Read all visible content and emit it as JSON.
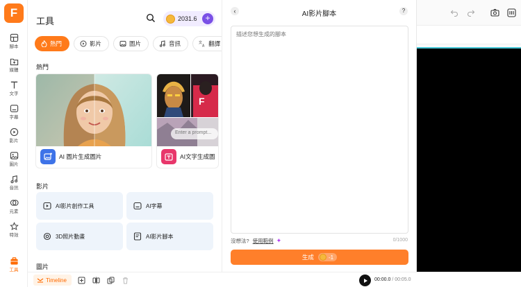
{
  "logo": {
    "letter": "F"
  },
  "rail": {
    "items": [
      {
        "label": "腳本",
        "icon": "script-icon"
      },
      {
        "label": "媒體",
        "icon": "media-icon"
      },
      {
        "label": "文字",
        "icon": "text-icon"
      },
      {
        "label": "字幕",
        "icon": "subtitle-icon"
      },
      {
        "label": "影片",
        "icon": "video-icon"
      },
      {
        "label": "圖片",
        "icon": "image-icon"
      },
      {
        "label": "音訊",
        "icon": "audio-icon"
      },
      {
        "label": "元素",
        "icon": "elements-icon"
      },
      {
        "label": "特效",
        "icon": "effects-icon"
      },
      {
        "label": "工具",
        "icon": "tools-icon"
      }
    ]
  },
  "panel": {
    "title": "工具",
    "credits": "2031.6",
    "tabs": [
      {
        "label": "熱門",
        "icon": "fire-icon"
      },
      {
        "label": "影片",
        "icon": "video-icon"
      },
      {
        "label": "圖片",
        "icon": "image-icon"
      },
      {
        "label": "音訊",
        "icon": "music-icon"
      },
      {
        "label": "翻譯",
        "icon": "translate-icon"
      }
    ],
    "hot_title": "熱門",
    "cards": [
      {
        "label": "AI 圖片生成圖片"
      },
      {
        "label": "AI文字生成圖",
        "prompt_placeholder": "Enter a prompt..."
      }
    ],
    "video_title": "影片",
    "video_tools": [
      {
        "label": "AI影片創作工具",
        "icon": "video-create-icon"
      },
      {
        "label": "AI字幕",
        "icon": "subtitle-icon"
      },
      {
        "label": "3D照片動畫",
        "icon": "3d-photo-icon"
      },
      {
        "label": "AI影片腳本",
        "icon": "script-icon"
      }
    ],
    "image_title": "圖片"
  },
  "script": {
    "title": "AI影片腳本",
    "placeholder": "描述您想生成的腳本",
    "idea_text": "沒想法?",
    "example_link": "使用範例",
    "counter": "0/1000",
    "generate_label": "生成",
    "generate_cost": "-1"
  },
  "bottom": {
    "timeline_label": "Timeline",
    "current_time": "00:00.0",
    "total_time": "/ 00:05.0"
  },
  "colors": {
    "accent": "#ff7a1a",
    "credit_purple": "#7a50e6",
    "tool_bg": "#eef4fb"
  }
}
